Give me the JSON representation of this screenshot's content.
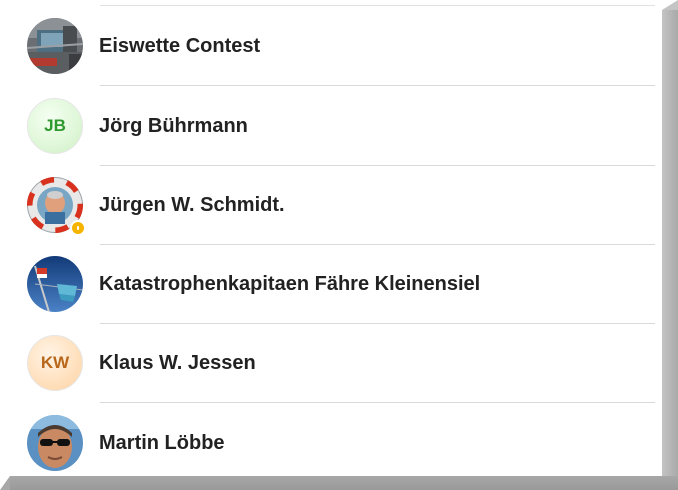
{
  "contacts": [
    {
      "name": "Eiswette Contest",
      "avatar_type": "photo",
      "avatar_icon": "harbor-photo-avatar"
    },
    {
      "name": "Jörg Bührmann",
      "avatar_type": "initials",
      "initials": "JB",
      "initials_color": "#2e9a2e",
      "avatar_bg": "#dff7d8"
    },
    {
      "name": "Jürgen W. Schmidt.",
      "avatar_type": "photo",
      "avatar_icon": "lifebuoy-photo-avatar",
      "status": "away",
      "status_color": "#f5b400"
    },
    {
      "name": "Katastrophenkapitaen Fähre Kleinensiel",
      "avatar_type": "photo",
      "avatar_icon": "ship-mast-flag-photo-avatar"
    },
    {
      "name": "Klaus W. Jessen",
      "avatar_type": "initials",
      "initials": "KW",
      "initials_color": "#b8661a",
      "avatar_bg": "#ffe0bd"
    },
    {
      "name": "Martin Löbbe",
      "avatar_type": "photo",
      "avatar_icon": "sunglasses-portrait-photo-avatar"
    }
  ]
}
